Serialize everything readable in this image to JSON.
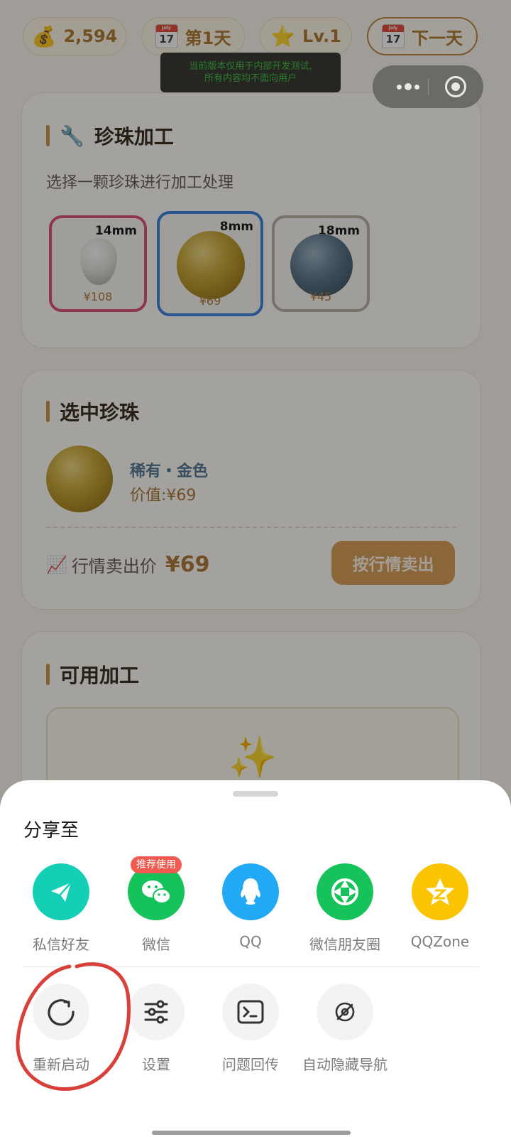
{
  "status_bar": {
    "coins": "2,594",
    "day": "第1天",
    "level": "Lv.1",
    "next_day_label": "下一天",
    "calendar_month": "July",
    "calendar_day": "17"
  },
  "dev_notice": {
    "line1": "当前版本仅用于内部开发测试,",
    "line2": "所有内容均不面向用户"
  },
  "processing_card": {
    "title": "珍珠加工",
    "subtitle": "选择一颗珍珠进行加工处理",
    "pearls": [
      {
        "size": "14mm",
        "price": "¥108",
        "border_color": "#e0557a"
      },
      {
        "size": "8mm",
        "price": "¥69",
        "border_color": "#3f86e0"
      },
      {
        "size": "18mm",
        "price": "¥45",
        "border_color": "#b9b4a8"
      }
    ]
  },
  "selected_card": {
    "title": "选中珍珠",
    "name": "稀有・金色",
    "value": "价值:¥69",
    "market_label": "行情卖出价",
    "market_price": "¥69",
    "sell_button": "按行情卖出"
  },
  "available_card": {
    "title": "可用加工"
  },
  "share_sheet": {
    "title": "分享至",
    "recommend_badge": "推荐使用",
    "share_items": [
      {
        "label": "私信好友",
        "icon": "paper-plane-icon",
        "color": "#12cfb6"
      },
      {
        "label": "微信",
        "icon": "wechat-icon",
        "color": "#16c25a"
      },
      {
        "label": "QQ",
        "icon": "qq-penguin-icon",
        "color": "#22a9f5"
      },
      {
        "label": "微信朋友圈",
        "icon": "moments-icon",
        "color": "#16c25a"
      },
      {
        "label": "QQZone",
        "icon": "qzone-star-icon",
        "color": "#fbc400"
      }
    ],
    "actions": [
      {
        "label": "重新启动",
        "icon": "restart-icon"
      },
      {
        "label": "设置",
        "icon": "settings-sliders-icon"
      },
      {
        "label": "问题回传",
        "icon": "terminal-icon"
      },
      {
        "label": "自动隐藏导航",
        "icon": "hide-navigation-icon"
      }
    ]
  },
  "colors": {
    "accent_gold": "#b07a3c",
    "annotation_red": "#d9403a"
  }
}
